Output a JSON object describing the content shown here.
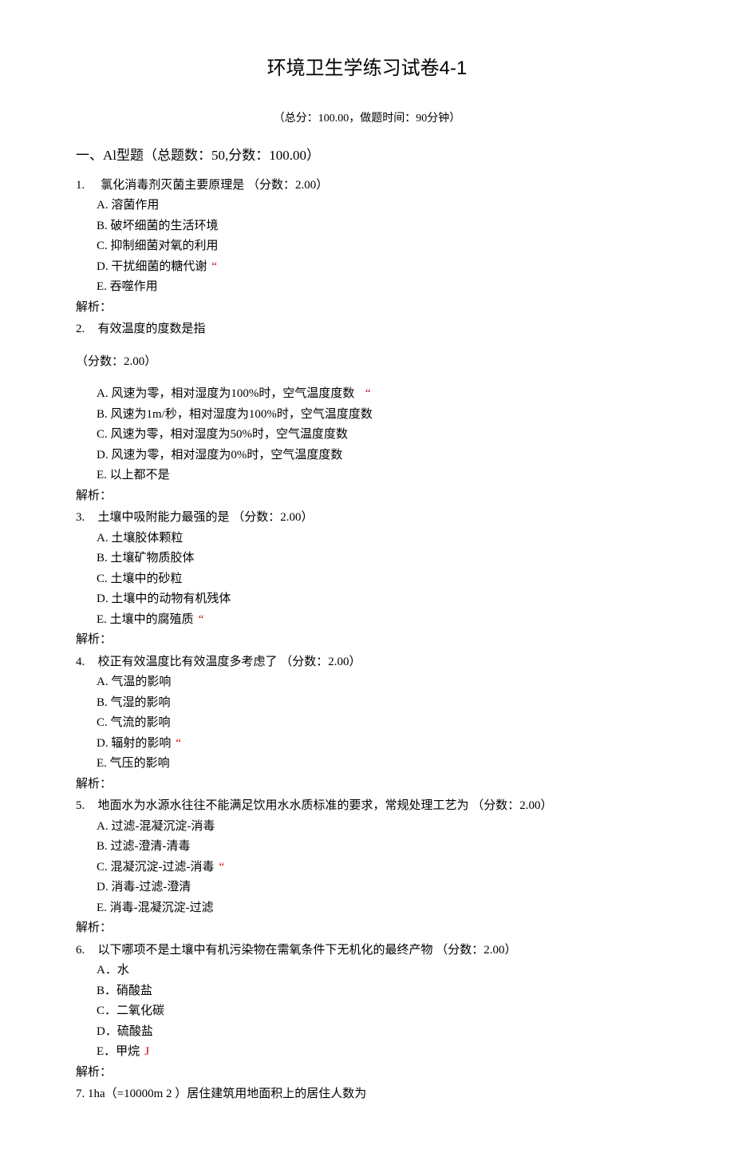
{
  "title": "环境卫生学练习试卷4-1",
  "subtitle": "（总分：100.00，做题时间：90分钟）",
  "section": "一、Al型题（总题数：50,分数：100.00）",
  "questions": [
    {
      "num": "1.",
      "stem": "氯化消毒剂灭菌主要原理是 （分数：2.00）",
      "options": [
        {
          "label": "A.",
          "text": "溶菌作用",
          "mark": ""
        },
        {
          "label": "B.",
          "text": "破坏细菌的生活环境",
          "mark": ""
        },
        {
          "label": "C.",
          "text": "抑制细菌对氧的利用",
          "mark": ""
        },
        {
          "label": "D.",
          "text": "干扰细菌的糖代谢",
          "mark": "“"
        },
        {
          "label": "E.",
          "text": "吞噬作用",
          "mark": ""
        }
      ],
      "jiexi": "解析："
    },
    {
      "num": "2.",
      "stem": "有效温度的度数是指",
      "score": "（分数：2.00）",
      "options": [
        {
          "label": "A.",
          "text": "风速为零，相对湿度为100%时，空气温度度数",
          "mark": "“"
        },
        {
          "label": "B.",
          "text": "风速为1m/秒，相对湿度为100%时，空气温度度数",
          "mark": ""
        },
        {
          "label": "C.",
          "text": "风速为零，相对湿度为50%时，空气温度度数",
          "mark": ""
        },
        {
          "label": "D.",
          "text": "风速为零，相对湿度为0%时，空气温度度数",
          "mark": ""
        },
        {
          "label": "E.",
          "text": "以上都不是",
          "mark": ""
        }
      ],
      "jiexi": "解析："
    },
    {
      "num": "3.",
      "stem": "土壤中吸附能力最强的是 （分数：2.00）",
      "options": [
        {
          "label": "A.",
          "text": "土壤胶体颗粒",
          "mark": ""
        },
        {
          "label": "B.",
          "text": "土壤矿物质胶体",
          "mark": ""
        },
        {
          "label": "C.",
          "text": "土壤中的砂粒",
          "mark": ""
        },
        {
          "label": "D.",
          "text": "土壤中的动物有机残体",
          "mark": ""
        },
        {
          "label": "E.",
          "text": "土壤中的腐殖质",
          "mark": "“"
        }
      ],
      "jiexi": "解析："
    },
    {
      "num": "4.",
      "stem": "校正有效温度比有效温度多考虑了 （分数：2.00）",
      "options": [
        {
          "label": "A.",
          "text": "气温的影响",
          "mark": ""
        },
        {
          "label": "B.",
          "text": "气湿的影响",
          "mark": ""
        },
        {
          "label": "C.",
          "text": "气流的影响",
          "mark": ""
        },
        {
          "label": "D.",
          "text": "辐射的影响",
          "mark": "“"
        },
        {
          "label": "E.",
          "text": "气压的影响",
          "mark": ""
        }
      ],
      "jiexi": "解析："
    },
    {
      "num": "5.",
      "stem": "地面水为水源水往往不能满足饮用水水质标准的要求，常规处理工艺为 （分数：2.00）",
      "options": [
        {
          "label": "A.",
          "text": "过滤-混凝沉淀-消毒",
          "mark": ""
        },
        {
          "label": "B.",
          "text": "过滤-澄清-清毒",
          "mark": ""
        },
        {
          "label": "C.",
          "text": "混凝沉淀-过滤-消毒",
          "mark": "“"
        },
        {
          "label": "D.",
          "text": "消毒-过滤-澄清",
          "mark": ""
        },
        {
          "label": "E.",
          "text": "消毒-混凝沉淀-过滤",
          "mark": ""
        }
      ],
      "jiexi": "解析："
    },
    {
      "num": "6.",
      "stem": "以下哪项不是土壤中有机污染物在需氧条件下无机化的最终产物 （分数：2.00）",
      "options": [
        {
          "label": "A．",
          "text": "水",
          "mark": ""
        },
        {
          "label": "B．",
          "text": "硝酸盐",
          "mark": ""
        },
        {
          "label": "C．",
          "text": "二氧化碳",
          "mark": ""
        },
        {
          "label": "D．",
          "text": "硫酸盐",
          "mark": ""
        },
        {
          "label": "E．",
          "text": "甲烷",
          "mark": "J"
        }
      ],
      "jiexi": "解析："
    }
  ],
  "q7": "7. 1ha（=10000m 2 ）居住建筑用地面积上的居住人数为"
}
